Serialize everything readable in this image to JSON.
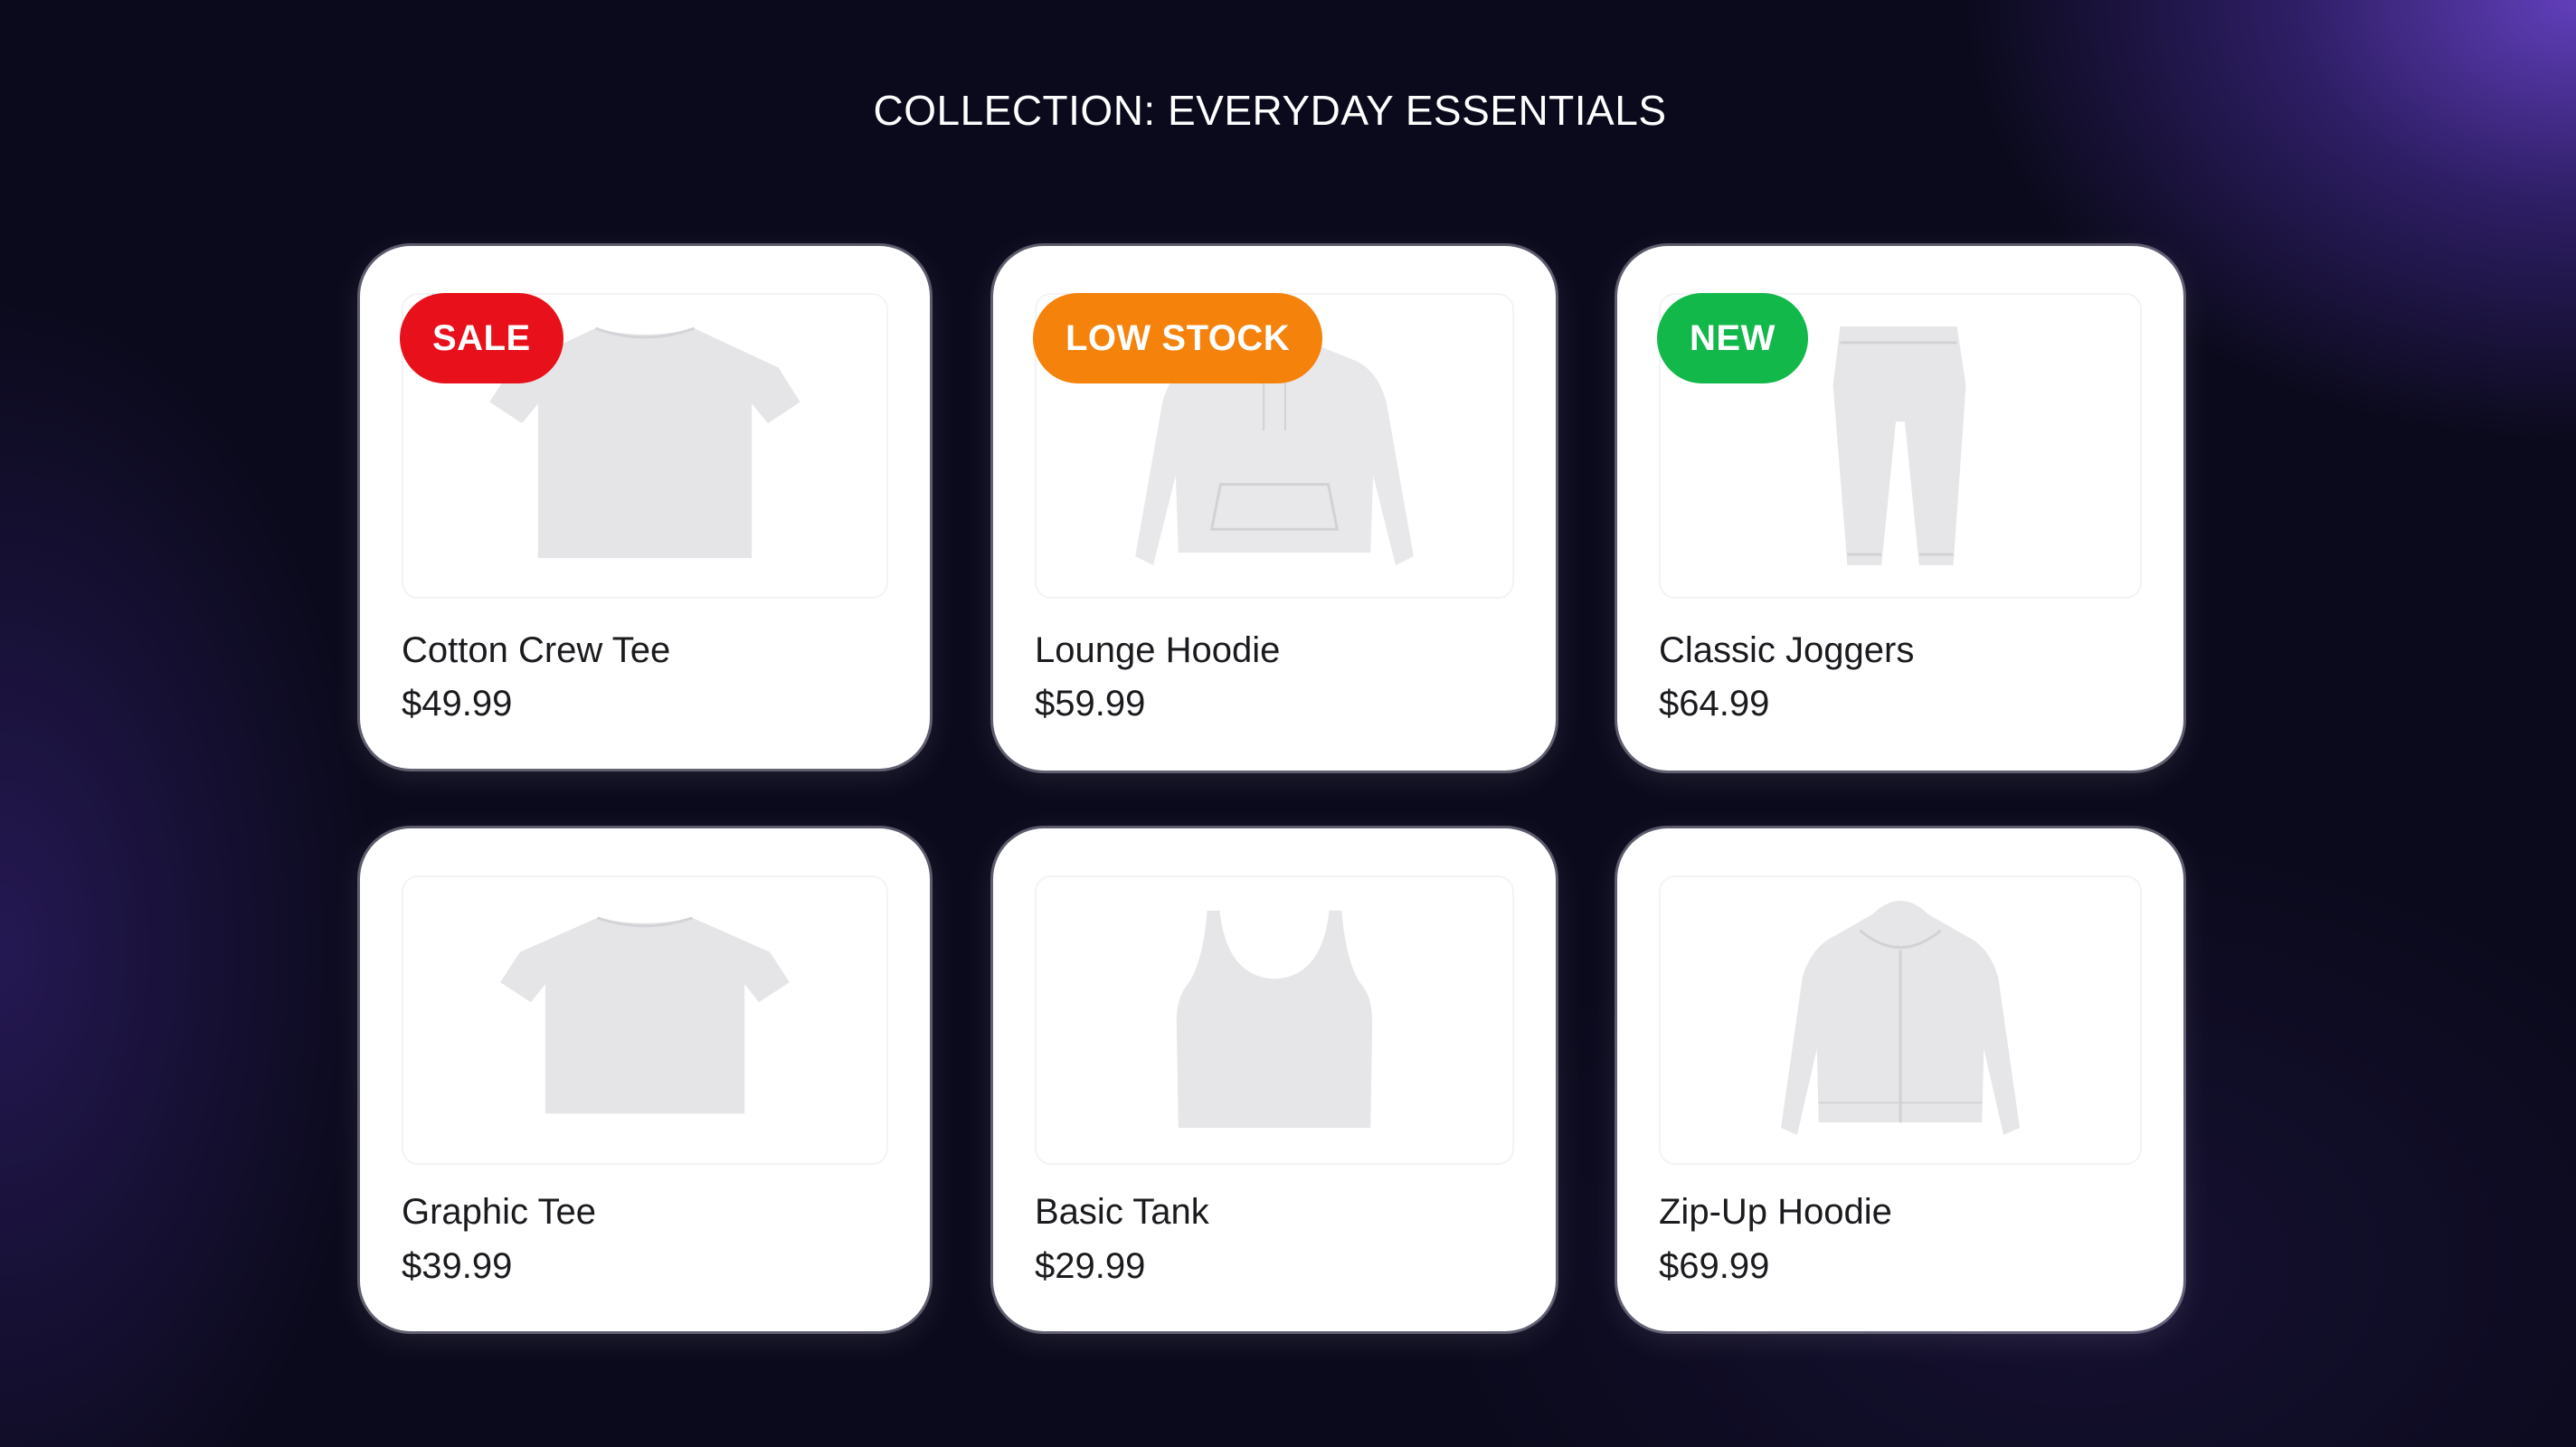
{
  "collection": {
    "title": "COLLECTION: EVERYDAY ESSENTIALS"
  },
  "colors": {
    "sale": "#e8101b",
    "low_stock": "#f5820b",
    "new": "#13b84a"
  },
  "products": [
    {
      "name": "Cotton Crew Tee",
      "price": "$49.99",
      "badge": "SALE",
      "icon": "t-shirt-icon"
    },
    {
      "name": "Lounge Hoodie",
      "price": "$59.99",
      "badge": "LOW STOCK",
      "icon": "hoodie-icon"
    },
    {
      "name": "Classic Joggers",
      "price": "$64.99",
      "badge": "NEW",
      "icon": "joggers-icon"
    },
    {
      "name": "Graphic Tee",
      "price": "$39.99",
      "icon": "t-shirt-icon"
    },
    {
      "name": "Basic Tank",
      "price": "$29.99",
      "icon": "tank-top-icon"
    },
    {
      "name": "Zip-Up Hoodie",
      "price": "$69.99",
      "icon": "zip-hoodie-icon"
    }
  ]
}
